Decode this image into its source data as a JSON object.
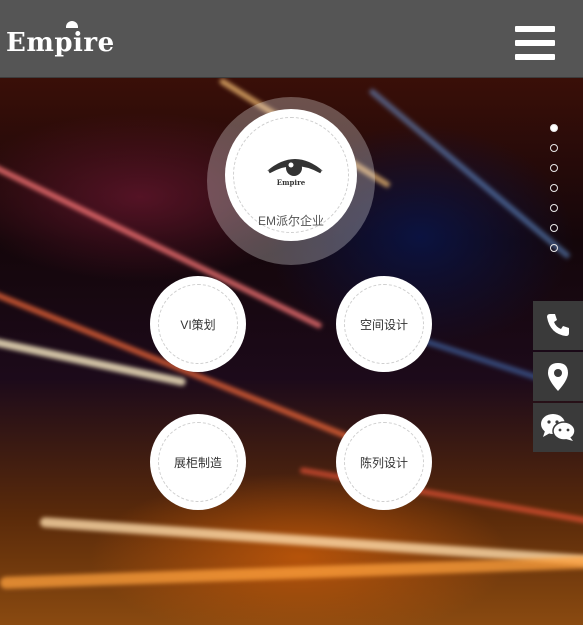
{
  "header": {
    "logo_text": "Empire",
    "menu_icon": "hamburger-menu-icon"
  },
  "main_circle": {
    "logo_word": "Empire",
    "label": "EM派尔企业",
    "icon": "eye-icon"
  },
  "nodes": [
    {
      "label": "VI策划"
    },
    {
      "label": "空间设计"
    },
    {
      "label": "展柜制造"
    },
    {
      "label": "陈列设计"
    }
  ],
  "pager": {
    "count": 7,
    "active_index": 0
  },
  "side_buttons": [
    {
      "icon": "phone-icon"
    },
    {
      "icon": "location-pin-icon"
    },
    {
      "icon": "wechat-icon"
    }
  ],
  "colors": {
    "header_bg": "#555555",
    "side_bg": "#3a3a3a"
  }
}
